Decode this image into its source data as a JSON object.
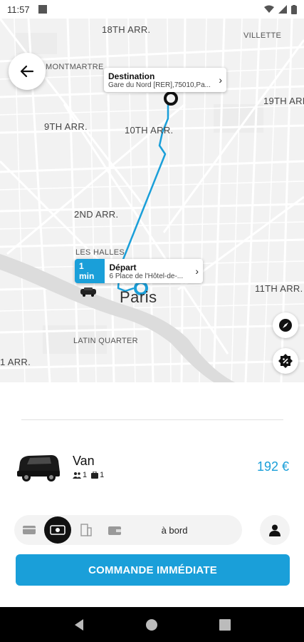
{
  "status_bar": {
    "time": "11:57"
  },
  "map": {
    "labels": {
      "arr18": "18TH ARR.",
      "villette": "VILLETTE",
      "montmartre": "MONTMARTRE",
      "arr19": "19TH ARR.",
      "arr9": "9TH ARR.",
      "arr10": "10TH ARR.",
      "arr2": "2ND ARR.",
      "les_halles": "LES HALLES",
      "paris": "Paris",
      "arr11": "11TH ARR.",
      "latin_quarter": "LATIN QUARTER",
      "arr1": "1 ARR."
    },
    "destination": {
      "title": "Destination",
      "address": "Gare du Nord [RER],75010,Pa..."
    },
    "departure": {
      "eta": "1 min",
      "title": "Départ",
      "address": "6 Place de l'Hôtel-de-..."
    }
  },
  "vehicle": {
    "name": "Van",
    "passengers": "1",
    "luggage": "1",
    "price": "192 €"
  },
  "payment": {
    "selected_label": "à bord"
  },
  "order_button": {
    "label": "COMMANDE IMMÉDIATE"
  },
  "colors": {
    "accent": "#1a9fd9",
    "dark": "#111111"
  }
}
